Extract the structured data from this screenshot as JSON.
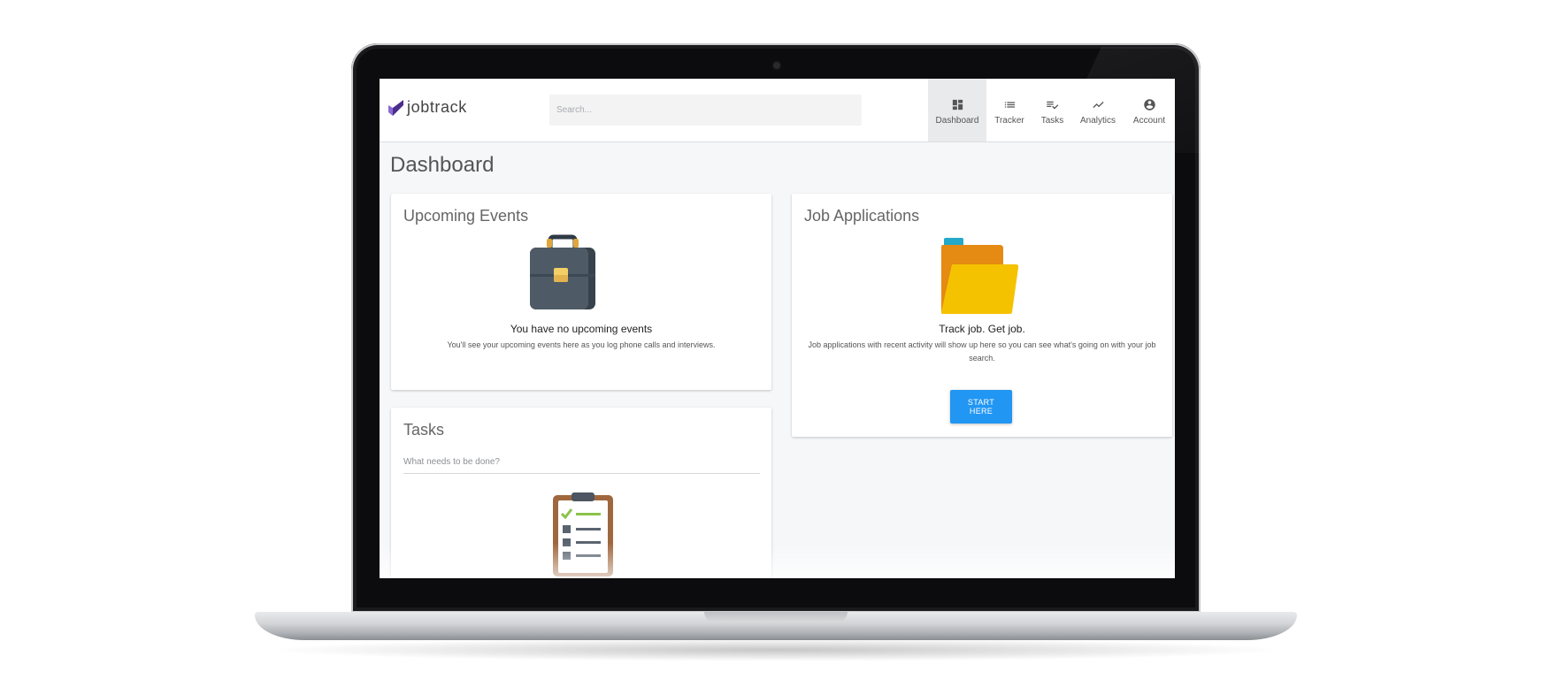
{
  "app": {
    "logo_text": "jobtrack",
    "brand_colors": {
      "logo_dark": "#4a2d8c",
      "logo_light": "#8a6ad6"
    }
  },
  "search": {
    "placeholder": "Search..."
  },
  "nav": {
    "items": [
      {
        "label": "Dashboard",
        "icon": "dashboard-icon",
        "active": true
      },
      {
        "label": "Tracker",
        "icon": "list-icon",
        "active": false
      },
      {
        "label": "Tasks",
        "icon": "playlist-check-icon",
        "active": false
      },
      {
        "label": "Analytics",
        "icon": "trending-up-icon",
        "active": false
      },
      {
        "label": "Account",
        "icon": "account-circle-icon",
        "active": false
      }
    ]
  },
  "page": {
    "title": "Dashboard"
  },
  "events_card": {
    "title": "Upcoming Events",
    "illustration": "briefcase-icon",
    "empty_heading": "You have no upcoming events",
    "empty_text": "You'll see your upcoming events here as you log phone calls and interviews."
  },
  "jobs_card": {
    "title": "Job Applications",
    "illustration": "folder-icon",
    "empty_heading": "Track job. Get job.",
    "empty_text": "Job applications with recent activity will show up here so you can see what's going on with your job search.",
    "button_label": "START HERE",
    "button_color": "#2196f3"
  },
  "tasks_card": {
    "title": "Tasks",
    "input_placeholder": "What needs to be done?",
    "illustration": "clipboard-checklist-icon"
  }
}
